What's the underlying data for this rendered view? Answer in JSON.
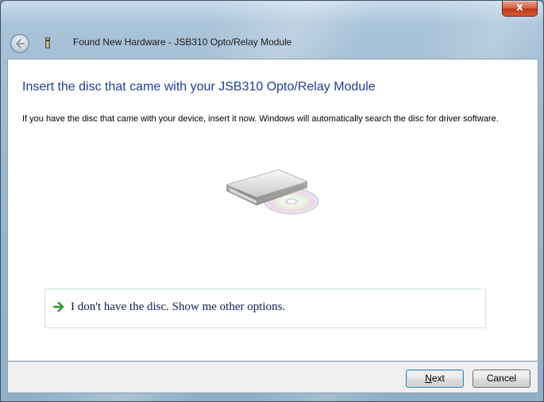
{
  "window": {
    "title": "Found New Hardware - JSB310 Opto/Relay Module",
    "close_label": "x"
  },
  "main": {
    "heading": "Insert the disc that came with your JSB310 Opto/Relay Module",
    "description": "If you have the disc that came with your device, insert it now.  Windows will automatically search the disc for driver software.",
    "option_label": "I don't have the disc.  Show me other options."
  },
  "footer": {
    "next_mnemonic": "N",
    "next_rest": "ext",
    "cancel_label": "Cancel"
  },
  "colors": {
    "heading": "#1e3f9c",
    "option_text": "#151c55",
    "arrow": "#2e9e2e"
  },
  "icons": {
    "back": "back-arrow-icon",
    "hardware": "hardware-device-icon",
    "disc": "disc-drive-icon",
    "option": "green-arrow-icon"
  }
}
